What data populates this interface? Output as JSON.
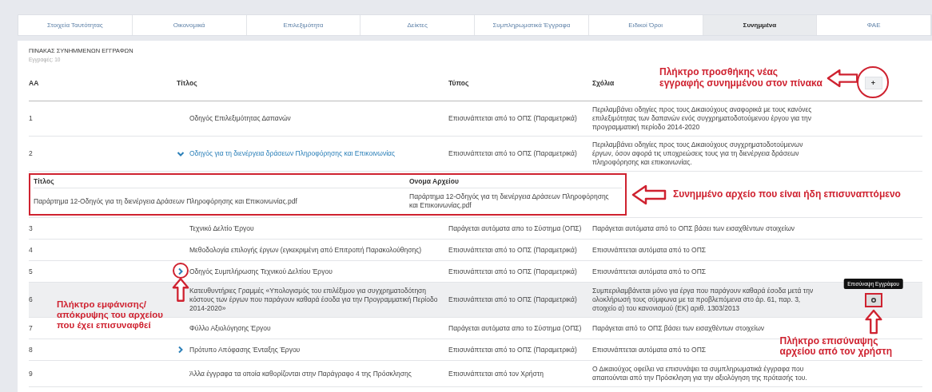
{
  "tabs": [
    {
      "label": "Στοιχεία Ταυτότητας",
      "selected": false
    },
    {
      "label": "Οικονομικά",
      "selected": false
    },
    {
      "label": "Επιλεξιμότητα",
      "selected": false
    },
    {
      "label": "Δείκτες",
      "selected": false
    },
    {
      "label": "Συμπληρωματικά Έγγραφα",
      "selected": false
    },
    {
      "label": "Ειδικοί Όροι",
      "selected": false
    },
    {
      "label": "Συνημμένα",
      "selected": true
    },
    {
      "label": "ΦΑΕ",
      "selected": false
    }
  ],
  "section": {
    "title": "ΠΙΝΑΚΑΣ ΣΥΝΗΜΜΕΝΩΝ ΕΓΓΡΑΦΩΝ",
    "count": "Εγγραφές: 10"
  },
  "table": {
    "columns": [
      "ΑΑ",
      "Τίτλος",
      "Τύπος",
      "Σχόλια"
    ],
    "add_button": "+",
    "rows": [
      {
        "aa": "1",
        "title": "Οδηγός Επιλεξιμότητας Δαπανών",
        "type": "Επισυνάπτεται από το ΟΠΣ (Παραμετρικά)",
        "comments": "Περιλαμβάνει οδηγίες προς τους Δικαιούχους αναφορικά με τους κανόνες επιλεξιμότητας των δαπανών ενός συγχρηματοδοτούμενου έργου για την προγραμματική περίοδο 2014-2020",
        "expandable": false,
        "expanded": false,
        "hovered": false
      },
      {
        "aa": "2",
        "title": "Οδηγός για τη διενέργεια δράσεων Πληροφόρησης και Επικοινωνίας",
        "type": "Επισυνάπτεται από το ΟΠΣ (Παραμετρικά)",
        "comments": "Περιλαμβάνει οδηγίες προς τους Δικαιούχους συγχρηματοδοτούμενων έργων, όσον αφορά τις υποχρεώσεις τους για τη διενέργεια δράσεων πληροφόρησης και επικοινωνίας.",
        "expandable": true,
        "expanded": true,
        "hovered": false,
        "attachments": {
          "columns": [
            "Τίτλος",
            "Ονομα Αρχείου"
          ],
          "rows": [
            {
              "title": "Παράρτημα 12-Οδηγός για τη διενέργεια Δράσεων Πληροφόρησης και Επικοινωνίας.pdf",
              "file_name": "Παράρτημα 12-Οδηγός για τη διενέργεια Δράσεων Πληροφόρησης και Επικοινωνίας.pdf"
            }
          ]
        }
      },
      {
        "aa": "3",
        "title": "Τεχνικό Δελτίο Έργου",
        "type": "Παράγεται αυτόματα απο το Σύστημα (ΟΠΣ)",
        "comments": "Παράγεται αυτόματα από το ΟΠΣ βάσει των εισαχθέντων στοιχείων",
        "expandable": false,
        "expanded": false,
        "hovered": false
      },
      {
        "aa": "4",
        "title": "Μεθοδολογία επιλογής έργων (εγκεκριμένη από Επιτροπή Παρακολούθησης)",
        "type": "Επισυνάπτεται από το ΟΠΣ (Παραμετρικά)",
        "comments": "Επισυνάπτεται αυτόματα από το ΟΠΣ",
        "expandable": false,
        "expanded": false,
        "hovered": false
      },
      {
        "aa": "5",
        "title": "Οδηγός Συμπλήρωσης Τεχνικού Δελτίου Έργου",
        "type": "Επισυνάπτεται από το ΟΠΣ (Παραμετρικά)",
        "comments": "Επισυνάπτεται αυτόματα από το ΟΠΣ",
        "expandable": true,
        "expanded": false,
        "hovered": false
      },
      {
        "aa": "6",
        "title": "Κατευθυντήριες Γραμμές «Υπολογισμός του επιλέξιμου για συγχρηματοδότηση κόστους των έργων που παράγουν καθαρά έσοδα για την Προγραμματική Περίοδο 2014-2020»",
        "type": "Επισυνάπτεται από το ΟΠΣ (Παραμετρικά)",
        "comments": "Συμπεριλαμβάνεται μόνο για έργα που παράγουν καθαρά έσοδα μετά την ολοκλήρωσή τους σύμφωνα με τα προβλεπόμενα στο άρ. 61, παρ. 3, στοιχείο α) του κανονισμού (ΕΚ) αριθ. 1303/2013",
        "expandable": false,
        "expanded": false,
        "hovered": true,
        "tooltip": "Επισύναψη Εγγράφου"
      },
      {
        "aa": "7",
        "title": "Φύλλο Αξιολόγησης Έργου",
        "type": "Παράγεται αυτόματα απο το Σύστημα (ΟΠΣ)",
        "comments": "Παράγεται από το ΟΠΣ βάσει των εισαχθέντων στοιχείων",
        "expandable": false,
        "expanded": false,
        "hovered": false
      },
      {
        "aa": "8",
        "title": "Πρότυπο Απόφασης Ένταξης Έργου",
        "type": "Επισυνάπτεται από το ΟΠΣ (Παραμετρικά)",
        "comments": "Επισυνάπτεται αυτόματα από το ΟΠΣ",
        "expandable": true,
        "expanded": false,
        "hovered": false
      },
      {
        "aa": "9",
        "title": "Άλλα έγγραφα τα οποία καθορίζονται στην Παράγραφο 4 της Πρόσκλησης",
        "type": "Επισυνάπτεται από τον Χρήστη",
        "comments": "Ο Δικαιούχος οφείλει να επισυνάψει τα συμπληρωματικά έγγραφα που απαιτούνται από την Πρόσκληση για την αξιολόγηση της πρότασής του.",
        "expandable": false,
        "expanded": false,
        "hovered": false
      }
    ]
  },
  "annotations": {
    "add_button": "Πλήκτρο προσθήκης νέας εγγραφής συνημμένου στον πίνακα",
    "attached_file": "Συνημμένο αρχείο που είναι ήδη επισυναπτόμενο",
    "toggle_button": "Πλήκτρο εμφάνισης/ απόκρυψης του αρχείου που έχει επισυναφθεί",
    "attach_button": "Πλήκτρο επισύναψης αρχείου από τον χρήστη"
  }
}
